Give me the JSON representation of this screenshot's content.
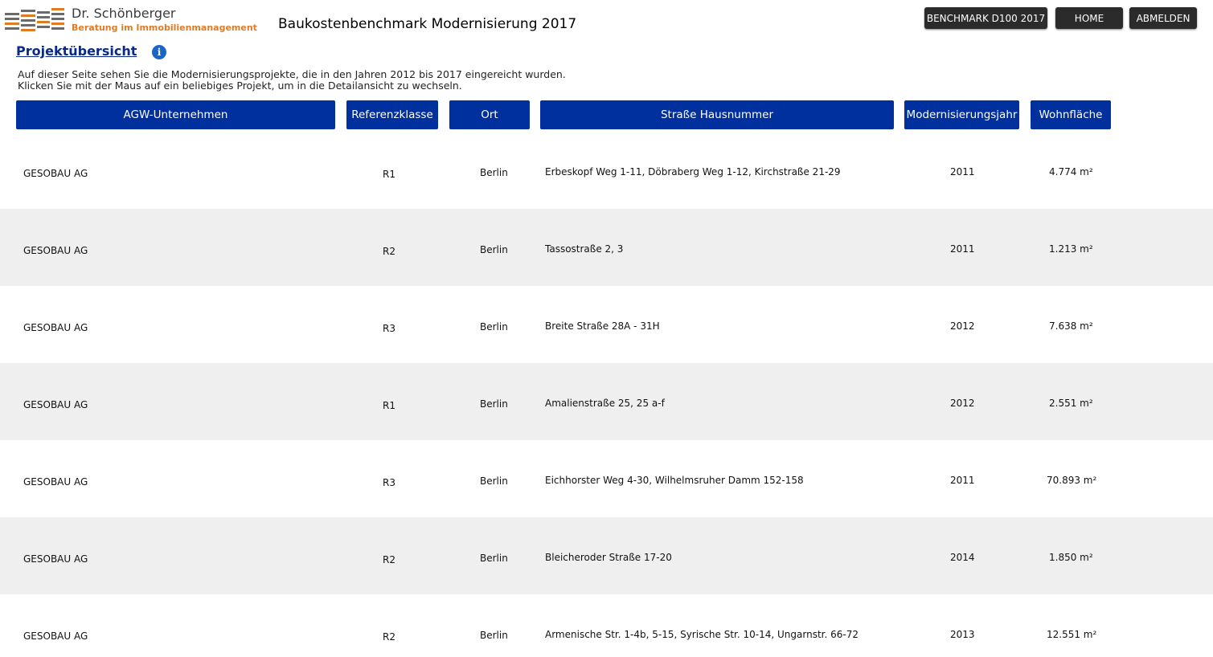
{
  "header": {
    "logo_name": "Dr. Schönberger",
    "logo_tagline": "Beratung im Immobilienmanagement",
    "app_title": "Baukostenbenchmark Modernisierung 2017",
    "buttons": {
      "benchmark": "BENCHMARK D100 2017",
      "home": "HOME",
      "logout": "ABMELDEN"
    }
  },
  "page": {
    "heading": "Projektübersicht",
    "info_icon": "info-icon",
    "intro_line1": "Auf dieser Seite sehen Sie die Modernisierungsprojekte, die in den Jahren 2012 bis 2017 eingereicht wurden.",
    "intro_line2": "Klicken Sie mit der Maus auf ein beliebiges Projekt, um in die Detailansicht zu wechseln."
  },
  "table": {
    "columns": [
      "AGW-Unternehmen",
      "Referenzklasse",
      "Ort",
      "Straße Hausnummer",
      "Modernisierungsjahr",
      "Wohnfläche"
    ],
    "rows": [
      {
        "company": "GESOBAU AG",
        "class": "R1",
        "city": "Berlin",
        "address": "Erbeskopf Weg 1-11, Döbraberg Weg 1-12, Kirchstraße 21-29",
        "year": "2011",
        "area": "4.774 m²"
      },
      {
        "company": "GESOBAU AG",
        "class": "R2",
        "city": "Berlin",
        "address": "Tassostraße 2, 3",
        "year": "2011",
        "area": "1.213 m²"
      },
      {
        "company": "GESOBAU AG",
        "class": "R3",
        "city": "Berlin",
        "address": "Breite Straße 28A - 31H",
        "year": "2012",
        "area": "7.638 m²"
      },
      {
        "company": "GESOBAU AG",
        "class": "R1",
        "city": "Berlin",
        "address": "Amalienstraße 25, 25 a-f",
        "year": "2012",
        "area": "2.551 m²"
      },
      {
        "company": "GESOBAU AG",
        "class": "R3",
        "city": "Berlin",
        "address": "Eichhorster Weg 4-30, Wilhelmsruher Damm 152-158",
        "year": "2011",
        "area": "70.893 m²"
      },
      {
        "company": "GESOBAU AG",
        "class": "R2",
        "city": "Berlin",
        "address": "Bleicheroder Straße 17-20",
        "year": "2014",
        "area": "1.850 m²"
      },
      {
        "company": "GESOBAU AG",
        "class": "R2",
        "city": "Berlin",
        "address": "Armenische Str. 1-4b, 5-15, Syrische Str. 10-14, Ungarnstr. 66-72",
        "year": "2013",
        "area": "12.551 m²"
      }
    ]
  },
  "colors": {
    "header_button_bg": "#2b2b2b",
    "column_header_bg": "#002f9e",
    "heading_link": "#0a2a8a",
    "logo_accent": "#e07b25",
    "row_alt_bg": "#efefef"
  }
}
